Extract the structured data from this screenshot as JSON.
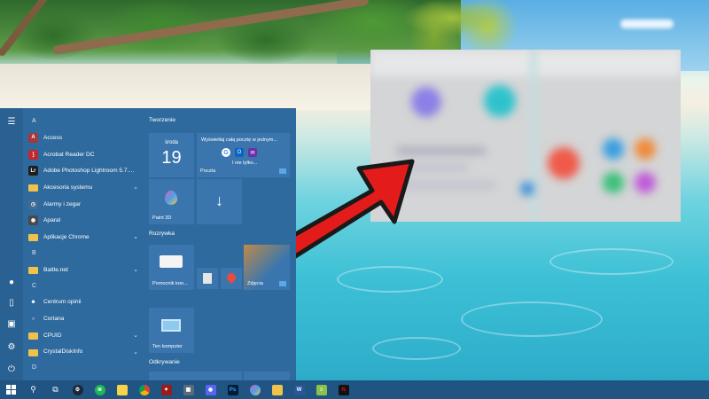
{
  "start_menu": {
    "rail": [
      "menu-icon",
      "user-icon",
      "document-icon",
      "pictures-icon",
      "settings-icon",
      "power-icon"
    ],
    "apps": [
      {
        "type": "letter",
        "label": "A"
      },
      {
        "type": "app",
        "label": "Access",
        "icon": "access-icon",
        "color": "#a4373a",
        "glyph": "A"
      },
      {
        "type": "app",
        "label": "Acrobat Reader DC",
        "icon": "acrobat-icon",
        "color": "#c1272d",
        "glyph": "⟆"
      },
      {
        "type": "app",
        "label": "Adobe Photoshop Lightroom 5.7.1 64...",
        "icon": "lightroom-icon",
        "color": "#1e1e1e",
        "glyph": "Lr"
      },
      {
        "type": "folder",
        "label": "Akcesoria systemu",
        "icon": "folder-icon",
        "chevron": true
      },
      {
        "type": "app",
        "label": "Alarmy i zegar",
        "icon": "clock-icon",
        "color": "#3f6b94",
        "glyph": "◷"
      },
      {
        "type": "app",
        "label": "Aparat",
        "icon": "camera-icon",
        "color": "#4a4a4a",
        "glyph": "◉"
      },
      {
        "type": "folder",
        "label": "Aplikacje Chrome",
        "icon": "folder-icon",
        "chevron": true
      },
      {
        "type": "letter",
        "label": "B"
      },
      {
        "type": "folder",
        "label": "Battle.net",
        "icon": "folder-icon",
        "chevron": true
      },
      {
        "type": "letter",
        "label": "C"
      },
      {
        "type": "app",
        "label": "Centrum opinii",
        "icon": "feedback-icon",
        "color": "#2f6a9e",
        "glyph": "☻"
      },
      {
        "type": "app",
        "label": "Cortana",
        "icon": "cortana-icon",
        "color": "#2f6a9e",
        "glyph": "○"
      },
      {
        "type": "folder",
        "label": "CPUID",
        "icon": "folder-icon",
        "chevron": true
      },
      {
        "type": "folder",
        "label": "CrystalDiskInfo",
        "icon": "folder-icon",
        "chevron": true
      },
      {
        "type": "letter",
        "label": "D"
      }
    ],
    "groups": {
      "tworzenie": "Tworzenie",
      "rozrywka": "Rozrywka",
      "odkrywanie": "Odkrywanie"
    },
    "tiles": {
      "calendar": {
        "day": "środa",
        "date": "19"
      },
      "mail": {
        "headline": "Wyświetlaj całą pocztę w jednym...",
        "more": "I nie tylko...",
        "label": "Poczta"
      },
      "paint3d": {
        "label": "Paint 3D"
      },
      "download": {
        "label": ""
      },
      "quickassist": {
        "label": "Pomocnik kon..."
      },
      "photos": {
        "label": "Zdjęcia"
      },
      "computer": {
        "label": "Ten komputer"
      }
    }
  },
  "taskbar": {
    "items": [
      "start-icon",
      "search-icon",
      "task-view-icon",
      "steam-icon",
      "spotify-icon",
      "sticky-notes-icon",
      "chrome-icon",
      "app-red-icon",
      "calculator-icon",
      "discord-icon",
      "photoshop-icon",
      "paint3d-icon",
      "file-explorer-icon",
      "word-icon",
      "notepad-icon",
      "netflix-icon"
    ],
    "colors": {
      "bar": "#1f5483",
      "steam": "#1b2838",
      "spotify": "#1db954",
      "sticky": "#f7d44a",
      "chrome": "#e8a21a",
      "app_red": "#9a1b1b",
      "discord": "#5865f2",
      "photoshop": "#001e36",
      "explorer": "#f0c24a",
      "word": "#2b579a",
      "notepad": "#8bc34a",
      "netflix": "#111111"
    }
  },
  "colors": {
    "start_bg": "#2f6a9e",
    "tile_bg": "#3a76ad",
    "arrow": "#e31b1b"
  }
}
